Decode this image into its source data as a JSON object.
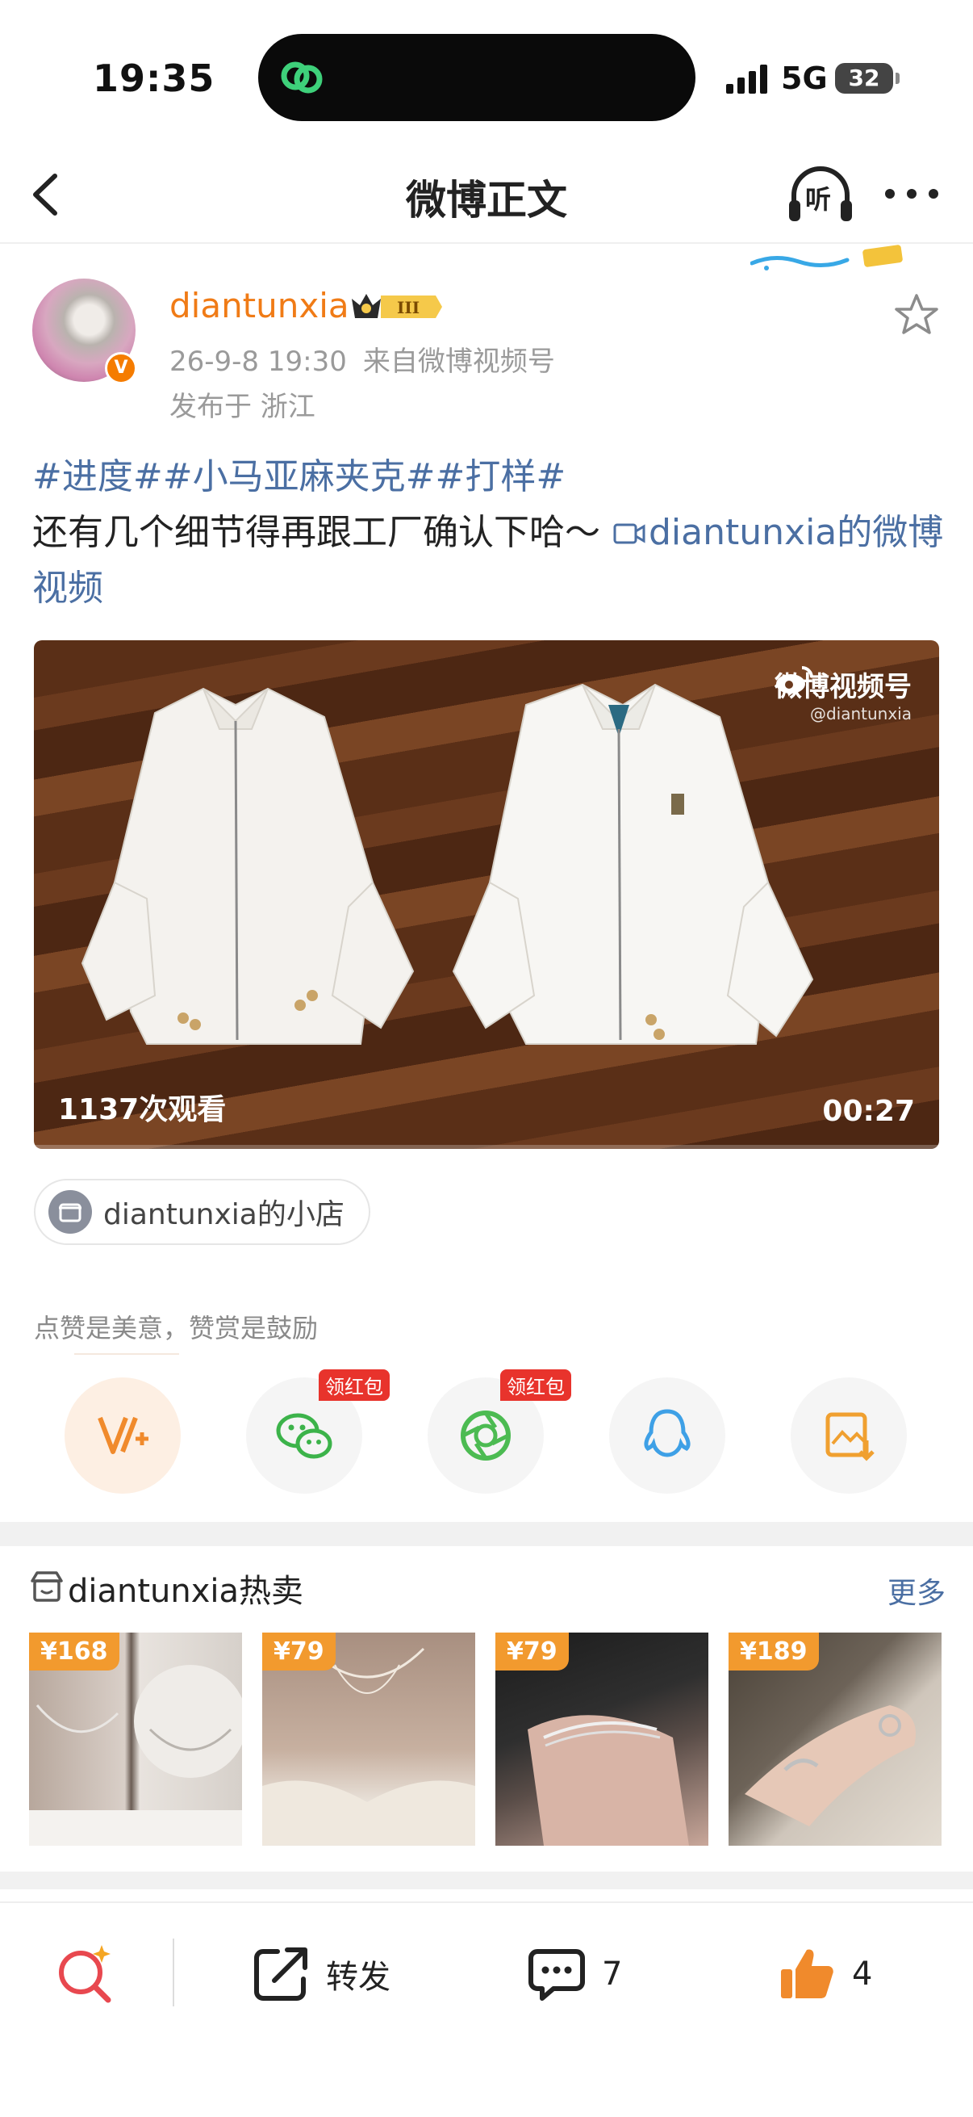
{
  "status_bar": {
    "time": "19:35",
    "network": "5G",
    "battery": "32"
  },
  "nav": {
    "title": "微博正文",
    "listen_label": "听"
  },
  "post": {
    "username": "diantunxia",
    "vip_level": "III",
    "timestamp": "26-9-8 19:30",
    "source": "来自微博视频号",
    "location": "发布于 浙江",
    "hashtags": "#进度##小马亚麻夹克##打样#",
    "body": "还有几个细节得再跟工厂确认下哈～",
    "video_link": "diantunxia的微博视频",
    "video": {
      "watermark_title": "微博视频号",
      "watermark_handle": "@diantunxia",
      "views": "1137次观看",
      "duration": "00:27"
    },
    "shop_chip": "diantunxia的小店"
  },
  "appreciation": {
    "text": "点赞是美意，赞赏是鼓励",
    "share_targets": [
      {
        "icon": "reward-icon",
        "tag": ""
      },
      {
        "icon": "wechat-icon",
        "tag": "领红包"
      },
      {
        "icon": "moments-icon",
        "tag": "领红包"
      },
      {
        "icon": "qq-icon",
        "tag": ""
      },
      {
        "icon": "save-image-icon",
        "tag": ""
      }
    ]
  },
  "hot_sale": {
    "title": "diantunxia热卖",
    "more": "更多",
    "products": [
      {
        "price": "¥168"
      },
      {
        "price": "¥79"
      },
      {
        "price": "¥79"
      },
      {
        "price": "¥189"
      }
    ]
  },
  "bottom_bar": {
    "repost_label": "转发",
    "comment_count": "7",
    "like_count": "4"
  },
  "colors": {
    "accent_orange": "#f07b16",
    "link_blue": "#4b6fa3",
    "red_tag": "#e8332c"
  }
}
